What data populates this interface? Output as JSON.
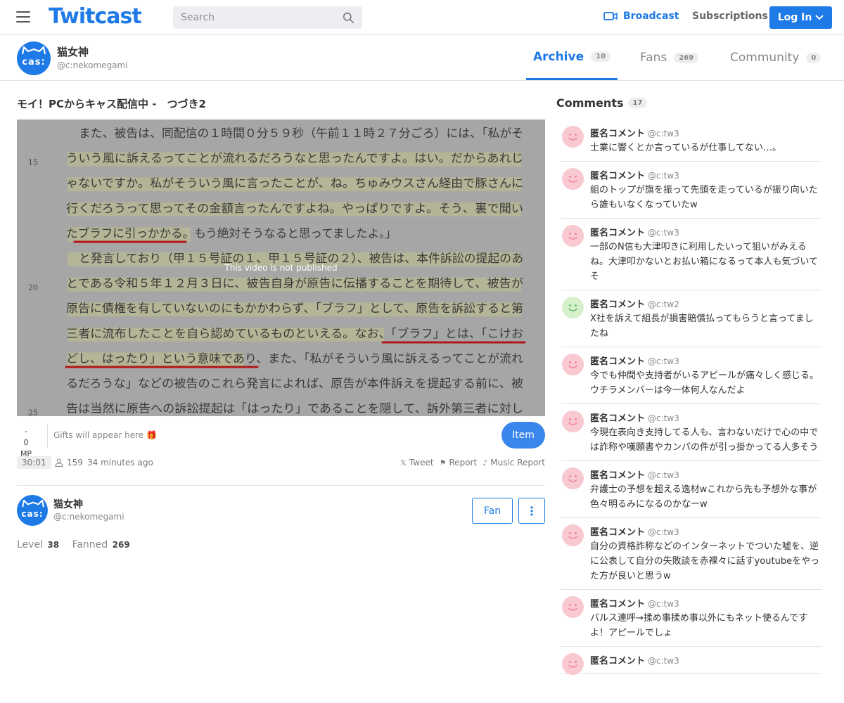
{
  "header": {
    "logo": "Twitcast",
    "search_placeholder": "Search",
    "broadcast_label": "Broadcast",
    "subscriptions_label": "Subscriptions",
    "login_label": "Log In",
    "brand_color": "#1e7ae6"
  },
  "profile": {
    "name": "猫女神",
    "handle": "@c:nekomegami",
    "avatar_text": "cas:"
  },
  "tabs": [
    {
      "label": "Archive",
      "count": "10",
      "active": true
    },
    {
      "label": "Fans",
      "count": "269",
      "active": false
    },
    {
      "label": "Community",
      "count": "0",
      "active": false
    }
  ],
  "video": {
    "title": "モイ！PCからキャス配信中 -　つづき2",
    "overlay_text": "This video is not published",
    "document_line_numbers": [
      "15",
      "20",
      "25"
    ],
    "document_lines": [
      "また、被告は、同配信の１時間０分５９秒（午前１１時２７分ごろ）には、「私がそ",
      "ういう風に訴えるってことが流れるだろうなと思ったんですよ。はい。だからあれじ",
      "ゃないですか。私がそういう風に言ったことが、ね。ちゅみウスさん経由で豚さんに",
      "行くだろうって思ってその金額言ったんですよね。やっぱりですよ。そう、裏で聞い",
      "たブラフに引っかかる。もう絶対そうなると思ってましたよ。」",
      "と発言しており（甲１５号証の１、甲１５号証の２）、被告は、本件訴訟の提起のあ",
      "とである令和５年１２月３日に、被告自身が原告に伝播することを期待して、被告が",
      "原告に債権を有していないのにもかかわらず、「ブラフ」として、原告を訴訟すると第",
      "三者に流布したことを自ら認めているものといえる。なお、「ブラフ」とは、「こけお",
      "どし、はったり」という意味であり、また、「私がそういう風に訴えるってことが流れ",
      "るだろうな」などの被告のこれら発言によれば、原告が本件訴えを提起する前に、被",
      "告は当然に原告への訴訟提起は「はったり」であることを隠して、訴外第三者に対し"
    ],
    "mp_value": "-",
    "mp_label": "0 MP",
    "gifts_text": "Gifts will appear here 🎁",
    "item_button": "Item",
    "duration": "30:01",
    "views": "159",
    "posted_ago": "34 minutes ago",
    "actions": [
      "Tweet",
      "Report",
      "Music Report"
    ]
  },
  "owner": {
    "name": "猫女神",
    "handle": "@c:nekomegami",
    "fan_button": "Fan",
    "level_label": "Level",
    "level_value": "38",
    "fanned_label": "Fanned",
    "fanned_value": "269"
  },
  "comments_section": {
    "title": "Comments",
    "count": "17",
    "items": [
      {
        "name": "匿名コメント",
        "handle": "@c:tw3",
        "text": "士業に響くとか言っているが仕事してない…。",
        "face_color": "#f8c9d0"
      },
      {
        "name": "匿名コメント",
        "handle": "@c:tw3",
        "text": "組のトップが旗を振って先頭を走っているが振り向いたら誰もいなくなっていたw",
        "face_color": "#f8c9d0"
      },
      {
        "name": "匿名コメント",
        "handle": "@c:tw3",
        "text": "一部のN信も大津叩きに利用したいって狙いがみえるね。大津叩かないとお払い箱になるって本人も気づいてそ",
        "face_color": "#f8c9d0"
      },
      {
        "name": "匿名コメント",
        "handle": "@c:tw2",
        "text": "X社を訴えて組長が損害賠償払ってもらうと言ってましたね",
        "face_color": "#d6f0cc"
      },
      {
        "name": "匿名コメント",
        "handle": "@c:tw3",
        "text": "今でも仲間や支持者がいるアピールが痛々しく感じる。ウチラメンバーは今一体何人なんだよ",
        "face_color": "#f8c9d0"
      },
      {
        "name": "匿名コメント",
        "handle": "@c:tw3",
        "text": "今現在表向き支持してる人も、言わないだけで心の中では詐称や嘆願書やカンパの件が引っ掛かってる人多そう",
        "face_color": "#f8c9d0"
      },
      {
        "name": "匿名コメント",
        "handle": "@c:tw3",
        "text": "弁護士の予想を超える逸材wこれから先も予想外な事が色々明るみになるのかなーw",
        "face_color": "#f8c9d0"
      },
      {
        "name": "匿名コメント",
        "handle": "@c:tw3",
        "text": "自分の資格詐称などのインターネットでついた嘘を、逆に公表して自分の失敗談を赤裸々に話すyoutubeをやった方が良いと思うw",
        "face_color": "#f8c9d0"
      },
      {
        "name": "匿名コメント",
        "handle": "@c:tw3",
        "text": "バルス連呼→揉め事揉め事以外にもネット使るんですよ！アピールでしょ",
        "face_color": "#f8c9d0"
      },
      {
        "name": "匿名コメント",
        "handle": "@c:tw3",
        "text": "",
        "face_color": "#f8c9d0"
      }
    ]
  }
}
